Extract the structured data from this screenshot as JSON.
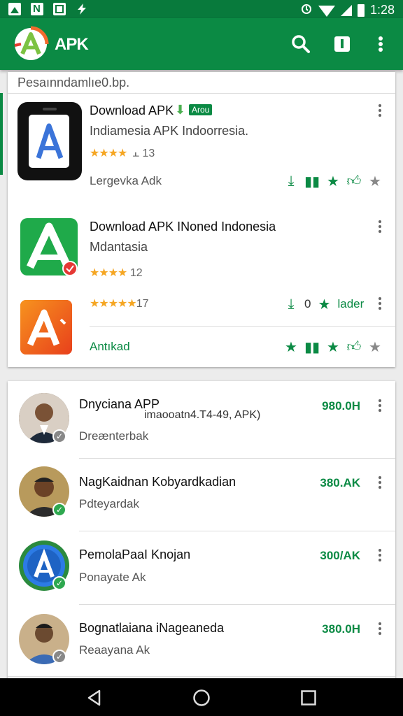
{
  "status_bar": {
    "time": "1:28",
    "left_icons": [
      "gallery-icon",
      "n-icon",
      "box-icon",
      "flash-icon"
    ],
    "right_icons": [
      "alarm-icon",
      "wifi-icon",
      "signal-icon",
      "battery-icon"
    ]
  },
  "app_bar": {
    "title": "APK",
    "actions": [
      "search-icon",
      "book-icon",
      "more-vert-icon"
    ],
    "color": "#0b8a44"
  },
  "featured": {
    "section_title": "Pesaınndamlıe0.bp.",
    "items": [
      {
        "name": "Download APK",
        "badge": "Arou",
        "subtitle": "Indiamesia APK Indoorresia.",
        "stars": "★★★★",
        "rating_suffix": " ⫠ 13",
        "developer": "Lergevka Adk",
        "icon": "phone-a-icon"
      },
      {
        "name": "Download APK INoned Indonesia",
        "subtitle": "Mdantasia",
        "stars": "★★★★",
        "rating_suffix": " 12",
        "icon": "green-a-icon"
      },
      {
        "stars": "★★★★★",
        "rating_suffix": "17",
        "count": "0",
        "action_label": "lader",
        "developer": "Antıkad",
        "icon": "orange-a-icon"
      }
    ]
  },
  "list": {
    "items": [
      {
        "name": "Dnyciana APP",
        "subtitle": "Dreænterbak",
        "extra": "imaooatn4.T4-49, APK)",
        "price": "980.0H",
        "verified": false
      },
      {
        "name": "NagKaidnan Kobyardkadian",
        "subtitle": "Pdteyardak",
        "price": "380.AK",
        "verified": true
      },
      {
        "name": "PemolaPaaI Knojan",
        "subtitle": "Ponayate Ak",
        "price": "300/AK",
        "verified": true
      },
      {
        "name": "Bognatlaiana iNageaneda",
        "subtitle": "Reaayana Ak",
        "price": "380.0H",
        "verified": false
      }
    ]
  },
  "nav_bar": {
    "buttons": [
      "back-icon",
      "home-icon",
      "recents-icon"
    ]
  }
}
